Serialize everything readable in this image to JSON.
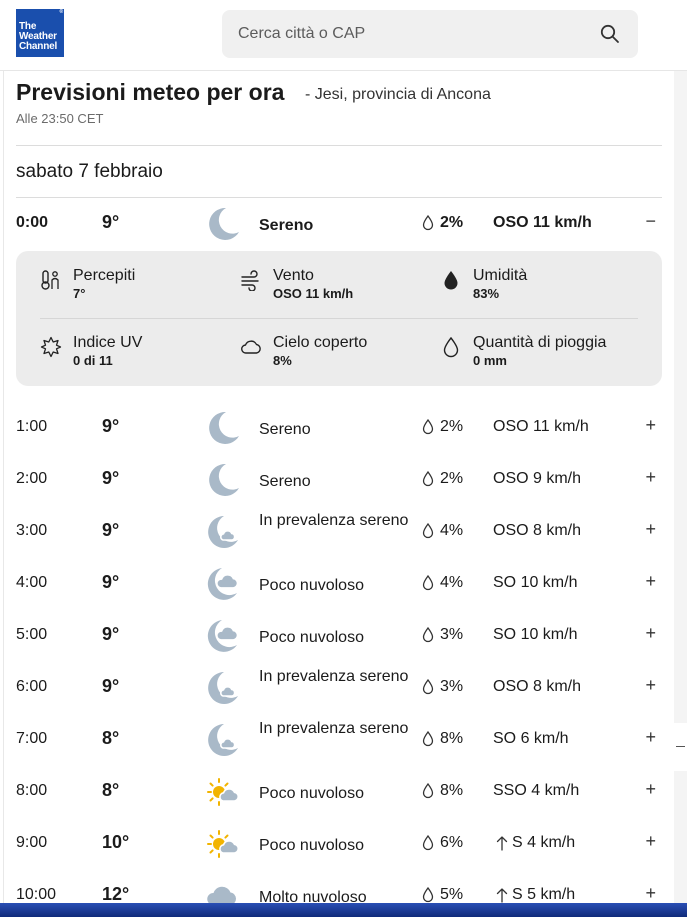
{
  "header": {
    "logo": {
      "line1": "The",
      "line2": "Weather",
      "line3": "Channel",
      "reg": "®"
    },
    "search": {
      "placeholder": "Cerca città o CAP",
      "icon": "search-icon"
    }
  },
  "page": {
    "title": "Previsioni meteo per ora",
    "location": "- Jesi, provincia di Ancona",
    "updated": "Alle 23:50 CET",
    "day": "sabato 7 febbraio"
  },
  "expanded": {
    "time": "0:00",
    "temp": "9°",
    "condition": "Sereno",
    "precip": "2%",
    "wind": "OSO 11 km/h",
    "toggle": "−",
    "details": [
      {
        "label": "Percepiti",
        "value": "7°",
        "icon": "thermometer-icon"
      },
      {
        "label": "Vento",
        "value": "OSO 11 km/h",
        "icon": "wind-icon"
      },
      {
        "label": "Umidità",
        "value": "83%",
        "icon": "humidity-drop-icon"
      },
      {
        "label": "Indice UV",
        "value": "0 di 11",
        "icon": "uv-sun-icon"
      },
      {
        "label": "Cielo coperto",
        "value": "8%",
        "icon": "cloud-icon"
      },
      {
        "label": "Quantità di pioggia",
        "value": "0 mm",
        "icon": "rain-drop-icon"
      }
    ]
  },
  "hours": [
    {
      "time": "1:00",
      "temp": "9°",
      "condition": "Sereno",
      "icon": "moon-icon",
      "precip": "2%",
      "wind": "OSO 11 km/h",
      "toggle": "+"
    },
    {
      "time": "2:00",
      "temp": "9°",
      "condition": "Sereno",
      "icon": "moon-icon",
      "precip": "2%",
      "wind": "OSO 9 km/h",
      "toggle": "+"
    },
    {
      "time": "3:00",
      "temp": "9°",
      "condition": "In prevalenza sereno",
      "icon": "moon-small-cloud-icon",
      "precip": "4%",
      "wind": "OSO 8 km/h",
      "toggle": "+"
    },
    {
      "time": "4:00",
      "temp": "9°",
      "condition": "Poco nuvoloso",
      "icon": "moon-cloud-icon",
      "precip": "4%",
      "wind": "SO 10 km/h",
      "toggle": "+"
    },
    {
      "time": "5:00",
      "temp": "9°",
      "condition": "Poco nuvoloso",
      "icon": "moon-cloud-icon",
      "precip": "3%",
      "wind": "SO 10 km/h",
      "toggle": "+"
    },
    {
      "time": "6:00",
      "temp": "9°",
      "condition": "In prevalenza sereno",
      "icon": "moon-small-cloud-icon",
      "precip": "3%",
      "wind": "OSO 8 km/h",
      "toggle": "+"
    },
    {
      "time": "7:00",
      "temp": "8°",
      "condition": "In prevalenza sereno",
      "icon": "moon-small-cloud-icon",
      "precip": "8%",
      "wind": "SO 6 km/h",
      "toggle": "+"
    },
    {
      "time": "8:00",
      "temp": "8°",
      "condition": "Poco nuvoloso",
      "icon": "sun-cloud-icon",
      "precip": "8%",
      "wind": "SSO 4 km/h",
      "toggle": "+"
    },
    {
      "time": "9:00",
      "temp": "10°",
      "condition": "Poco nuvoloso",
      "icon": "sun-cloud-icon",
      "precip": "6%",
      "wind": "S 4 km/h",
      "wind_arrow": true,
      "toggle": "+"
    },
    {
      "time": "10:00",
      "temp": "12°",
      "condition": "Molto nuvoloso",
      "icon": "cloud-icon",
      "precip": "5%",
      "wind": "S 5 km/h",
      "wind_arrow": true,
      "toggle": "+"
    }
  ]
}
